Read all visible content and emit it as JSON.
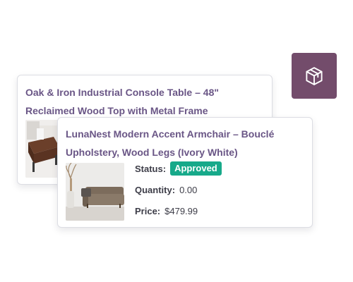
{
  "colors": {
    "title": "#6a5686",
    "accent_button": "#734c6b",
    "badge_approved": "#17a98a"
  },
  "box_button": {
    "icon": "package-box-icon"
  },
  "cards": [
    {
      "title": "Oak & Iron Industrial Console Table – 48\" Reclaimed Wood Top with Metal Frame",
      "image": "console-table-thumbnail"
    },
    {
      "title": "LunaNest Modern Accent Armchair – Bouclé Upholstery, Wood Legs (Ivory White)",
      "image": "sofa-thumbnail",
      "status_label": "Status:",
      "status_value": "Approved",
      "quantity_label": "Quantity:",
      "quantity_value": "0.00",
      "price_label": "Price:",
      "price_value": "$479.99"
    }
  ]
}
